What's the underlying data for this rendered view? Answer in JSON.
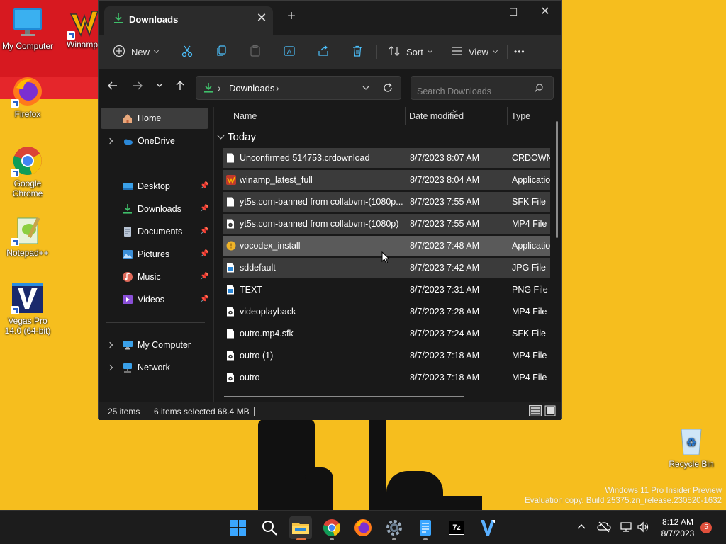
{
  "desktop": {
    "icons": [
      {
        "label": "My Computer"
      },
      {
        "label": "Winamp"
      },
      {
        "label": "Firefox"
      },
      {
        "label": "Google Chrome"
      },
      {
        "label": "Notepad++"
      },
      {
        "label": "Vegas Pro 14.0 (64-bit)"
      },
      {
        "label": "Recycle Bin"
      }
    ],
    "watermark_line1": "Windows 11 Pro Insider Preview",
    "watermark_line2": "Evaluation copy. Build 25375.zn_release.230520-1632"
  },
  "window": {
    "tab_title": "Downloads",
    "new_tab": "+",
    "close_tab": "✕",
    "minimize": "—",
    "maximize": "☐",
    "close": "✕"
  },
  "toolbar": {
    "new_label": "New",
    "sort_label": "Sort",
    "view_label": "View",
    "more_label": "•••"
  },
  "address": {
    "path": "Downloads",
    "separator": "›",
    "search_placeholder": "Search Downloads"
  },
  "sidebar": {
    "items": [
      {
        "label": "Home",
        "active": true
      },
      {
        "label": "OneDrive"
      },
      {
        "label": "Desktop",
        "pinned": true
      },
      {
        "label": "Downloads",
        "pinned": true
      },
      {
        "label": "Documents",
        "pinned": true
      },
      {
        "label": "Pictures",
        "pinned": true
      },
      {
        "label": "Music",
        "pinned": true
      },
      {
        "label": "Videos",
        "pinned": true
      },
      {
        "label": "My Computer"
      },
      {
        "label": "Network"
      }
    ]
  },
  "columns": {
    "name": "Name",
    "date": "Date modified",
    "type": "Type"
  },
  "group": {
    "label": "Today"
  },
  "files": [
    {
      "name": "Unconfirmed 514753.crdownload",
      "date": "8/7/2023 8:07 AM",
      "type": "CRDOWNLOAD",
      "selected": true
    },
    {
      "name": "winamp_latest_full",
      "date": "8/7/2023 8:04 AM",
      "type": "Application",
      "selected": true
    },
    {
      "name": "yt5s.com-banned from collabvm-(1080p...",
      "date": "8/7/2023 7:55 AM",
      "type": "SFK File",
      "selected": true
    },
    {
      "name": "yt5s.com-banned from collabvm-(1080p)",
      "date": "8/7/2023 7:55 AM",
      "type": "MP4 File",
      "selected": true
    },
    {
      "name": "vocodex_install",
      "date": "8/7/2023 7:48 AM",
      "type": "Application",
      "selected": true,
      "hover": true
    },
    {
      "name": "sddefault",
      "date": "8/7/2023 7:42 AM",
      "type": "JPG File",
      "selected": true
    },
    {
      "name": "TEXT",
      "date": "8/7/2023 7:31 AM",
      "type": "PNG File"
    },
    {
      "name": "videoplayback",
      "date": "8/7/2023 7:28 AM",
      "type": "MP4 File"
    },
    {
      "name": "outro.mp4.sfk",
      "date": "8/7/2023 7:24 AM",
      "type": "SFK File"
    },
    {
      "name": "outro (1)",
      "date": "8/7/2023 7:18 AM",
      "type": "MP4 File"
    },
    {
      "name": "outro",
      "date": "8/7/2023 7:18 AM",
      "type": "MP4 File"
    }
  ],
  "status": {
    "items": "25 items",
    "selected": "6 items selected",
    "size": "68.4 MB"
  },
  "taskbar": {
    "time": "8:12 AM",
    "date": "8/7/2023",
    "notifications": "5",
    "sevenzip_label": "7z"
  },
  "colors": {
    "accent": "#4cc2ff",
    "folder_green": "#3fbf6a",
    "wallpaper_yellow": "#f6be1e",
    "wallpaper_red": "#e5262b"
  }
}
